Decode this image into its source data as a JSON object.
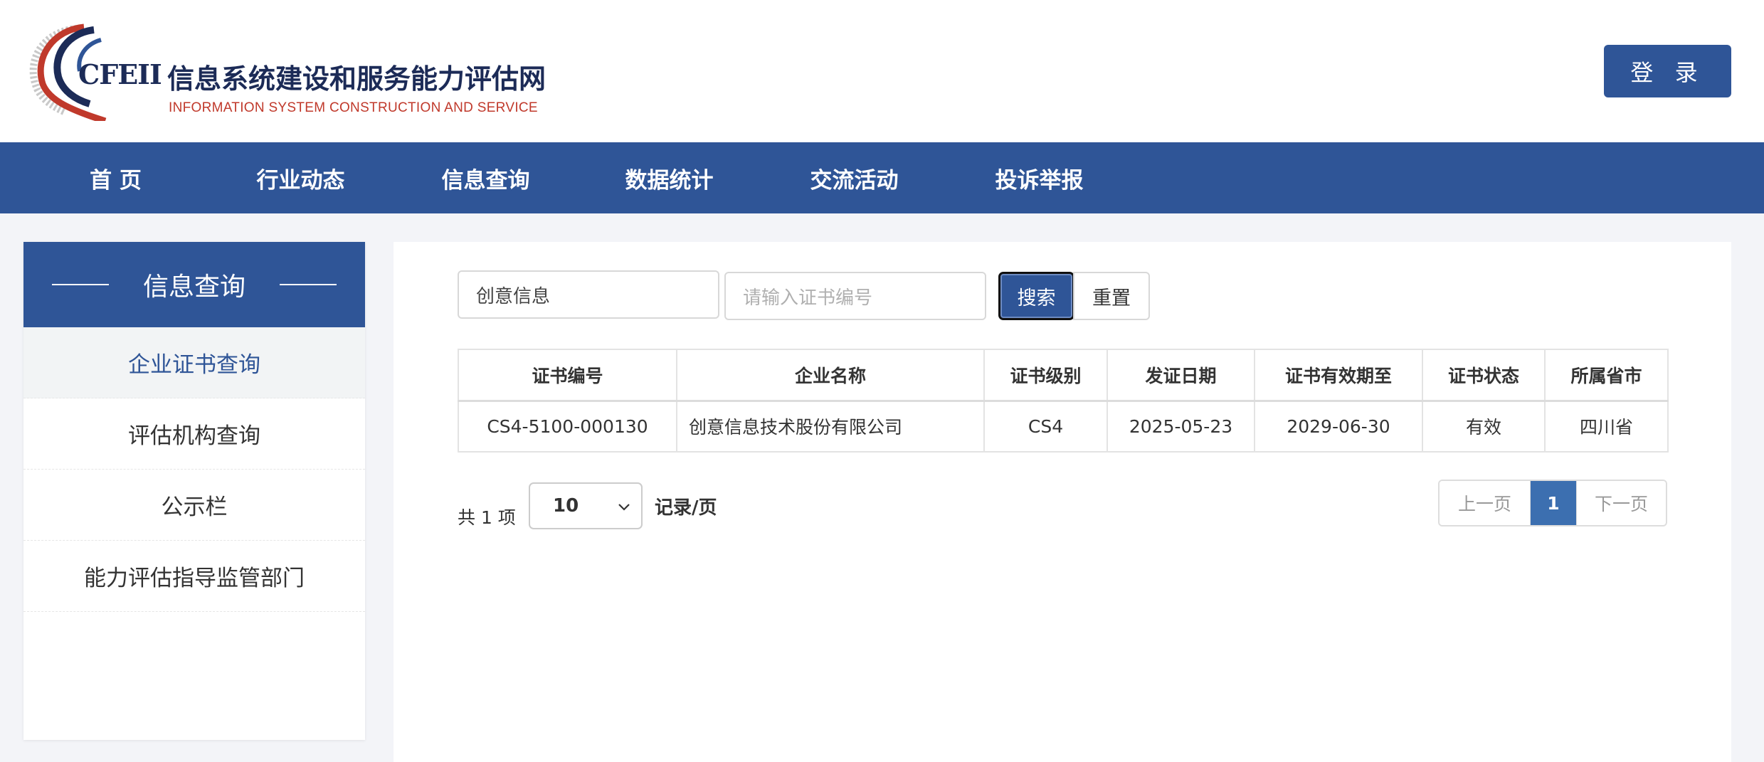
{
  "header": {
    "logo": {
      "abbr": "CFEII",
      "name_cn": "信息系统建设和服务能力评估网",
      "name_en": "INFORMATION SYSTEM CONSTRUCTION AND SERVICE"
    },
    "login_label": "登 录"
  },
  "nav": {
    "items": [
      {
        "label": "首 页"
      },
      {
        "label": "行业动态"
      },
      {
        "label": "信息查询"
      },
      {
        "label": "数据统计"
      },
      {
        "label": "交流活动"
      },
      {
        "label": "投诉举报"
      }
    ]
  },
  "sidebar": {
    "title": "信息查询",
    "items": [
      {
        "label": "企业证书查询",
        "active": true
      },
      {
        "label": "评估机构查询",
        "active": false
      },
      {
        "label": "公示栏",
        "active": false
      },
      {
        "label": "能力评估指导监管部门",
        "active": false
      }
    ]
  },
  "search": {
    "company_value": "创意信息",
    "cert_placeholder": "请输入证书编号",
    "search_label": "搜索",
    "reset_label": "重置"
  },
  "table": {
    "columns": [
      "证书编号",
      "企业名称",
      "证书级别",
      "发证日期",
      "证书有效期至",
      "证书状态",
      "所属省市"
    ],
    "rows": [
      [
        "CS4-5100-000130",
        "创意信息技术股份有限公司",
        "CS4",
        "2025-05-23",
        "2029-06-30",
        "有效",
        "四川省"
      ]
    ]
  },
  "pagination": {
    "total_text": "共 1 项",
    "page_size": "10",
    "per_page_label": "记录/页",
    "prev_label": "上一页",
    "current_page": "1",
    "next_label": "下一页"
  },
  "colors": {
    "primary": "#2f5597",
    "page_background": "#f3f4f8",
    "logo_red": "#c0392b",
    "logo_navy": "#1c2b57"
  }
}
